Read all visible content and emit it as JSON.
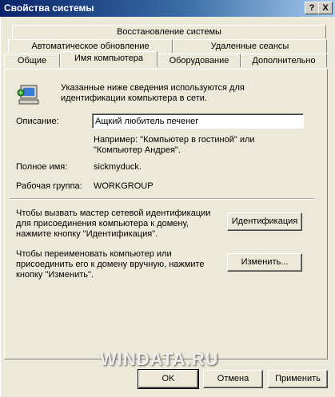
{
  "window": {
    "title": "Свойства системы",
    "help_button": "?",
    "close_button": "X"
  },
  "tabs": {
    "row1": [
      "Восстановление системы"
    ],
    "row2": [
      "Автоматическое обновление",
      "Удаленные сеансы"
    ],
    "row3": [
      "Общие",
      "Имя компьютера",
      "Оборудование",
      "Дополнительно"
    ],
    "active": "Имя компьютера"
  },
  "computer_name": {
    "intro_line1": "Указанные ниже сведения используются для",
    "intro_line2": "идентификации компьютера в сети.",
    "description_label": "Описание:",
    "description_value": "Ащкий любитель печенег",
    "example_line1": "Например: \"Компьютер в гостиной\" или",
    "example_line2": "\"Компьютер Андрея\".",
    "fullname_label": "Полное имя:",
    "fullname_value": "sickmyduck.",
    "workgroup_label": "Рабочая группа:",
    "workgroup_value": "WORKGROUP",
    "wizard_line1": "Чтобы вызвать мастер сетевой идентификации",
    "wizard_line2": "для присоединения компьютера к домену,",
    "wizard_line3": "нажмите кнопку \"Идентификация\".",
    "identify_button": "Идентификация",
    "rename_line1": "Чтобы переименовать компьютер или",
    "rename_line2": "присоединить его к домену вручную, нажмите",
    "rename_line3": "кнопку \"Изменить\".",
    "change_button": "Изменить..."
  },
  "footer": {
    "ok": "OK",
    "cancel": "Отмена",
    "apply": "Применить"
  },
  "watermark": "WINDATA.RU"
}
